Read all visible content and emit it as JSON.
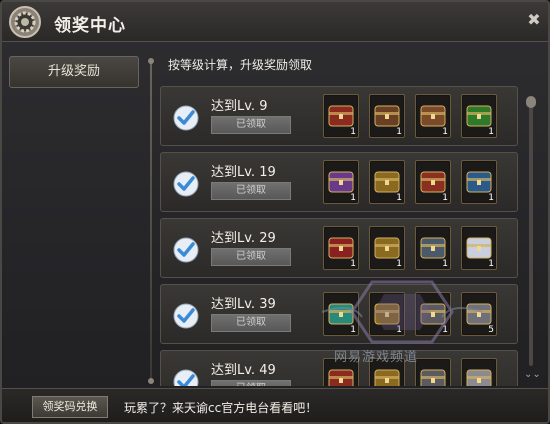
{
  "window": {
    "title": "领奖中心",
    "close_icon": "close-icon"
  },
  "sidebar": {
    "items": [
      {
        "label": "升级奖励",
        "selected": true
      }
    ]
  },
  "main": {
    "description": "按等级计算，升级奖励领取",
    "rows": [
      {
        "level": "达到Lv. 9",
        "status": "已领取",
        "checked": true,
        "items": [
          {
            "icon": "red-pouch-icon",
            "count": "1",
            "color": "#8b2b1f"
          },
          {
            "icon": "wooden-chest-icon",
            "count": "1",
            "color": "#6a4025"
          },
          {
            "icon": "bronze-chest-icon",
            "count": "1",
            "color": "#7a4a2a"
          },
          {
            "icon": "green-charm-icon",
            "count": "1",
            "color": "#2f7a2a"
          }
        ]
      },
      {
        "level": "达到Lv. 19",
        "status": "已领取",
        "checked": true,
        "items": [
          {
            "icon": "purple-pouch-icon",
            "count": "1",
            "color": "#6a3a8a"
          },
          {
            "icon": "gold-chest-icon",
            "count": "1",
            "color": "#8a6a20"
          },
          {
            "icon": "red-chest-icon",
            "count": "1",
            "color": "#8a3020"
          },
          {
            "icon": "blue-bag-icon",
            "count": "1",
            "color": "#2a5a8a"
          }
        ]
      },
      {
        "level": "达到Lv. 29",
        "status": "已领取",
        "checked": true,
        "items": [
          {
            "icon": "red-box-icon",
            "count": "1",
            "color": "#8a2020"
          },
          {
            "icon": "gold-chest-icon",
            "count": "1",
            "color": "#8a6a20"
          },
          {
            "icon": "steel-chest-icon",
            "count": "1",
            "color": "#4a5a6a"
          },
          {
            "icon": "white-wings-icon",
            "count": "1",
            "color": "#c8d0e0"
          }
        ]
      },
      {
        "level": "达到Lv. 39",
        "status": "已领取",
        "checked": true,
        "items": [
          {
            "icon": "gem-pendant-icon",
            "count": "1",
            "color": "#2a8a7a"
          },
          {
            "icon": "gold-chest-icon",
            "count": "1",
            "color": "#8a6a20"
          },
          {
            "icon": "steel-chest-icon",
            "count": "1",
            "color": "#5a5a60"
          },
          {
            "icon": "silver-orb-icon",
            "count": "5",
            "color": "#70707a"
          }
        ]
      },
      {
        "level": "达到Lv. 49",
        "status": "已领取",
        "checked": true,
        "items": [
          {
            "icon": "red-pouch-icon",
            "count": "",
            "color": "#8b2b1f"
          },
          {
            "icon": "gold-chest-icon",
            "count": "",
            "color": "#8a6a20"
          },
          {
            "icon": "steel-chest-icon",
            "count": "",
            "color": "#5a5a60"
          },
          {
            "icon": "blade-icon",
            "count": "",
            "color": "#8a8a90"
          }
        ]
      }
    ]
  },
  "footer": {
    "code_button": "领奖码兑换",
    "promo": "玩累了？来天谕cc官方电台看看吧！"
  },
  "watermark": {
    "text": "网易游戏频道"
  },
  "colors": {
    "accent": "#6a655c",
    "check": "#3a8ad8",
    "claimed_bg": "#666666"
  }
}
